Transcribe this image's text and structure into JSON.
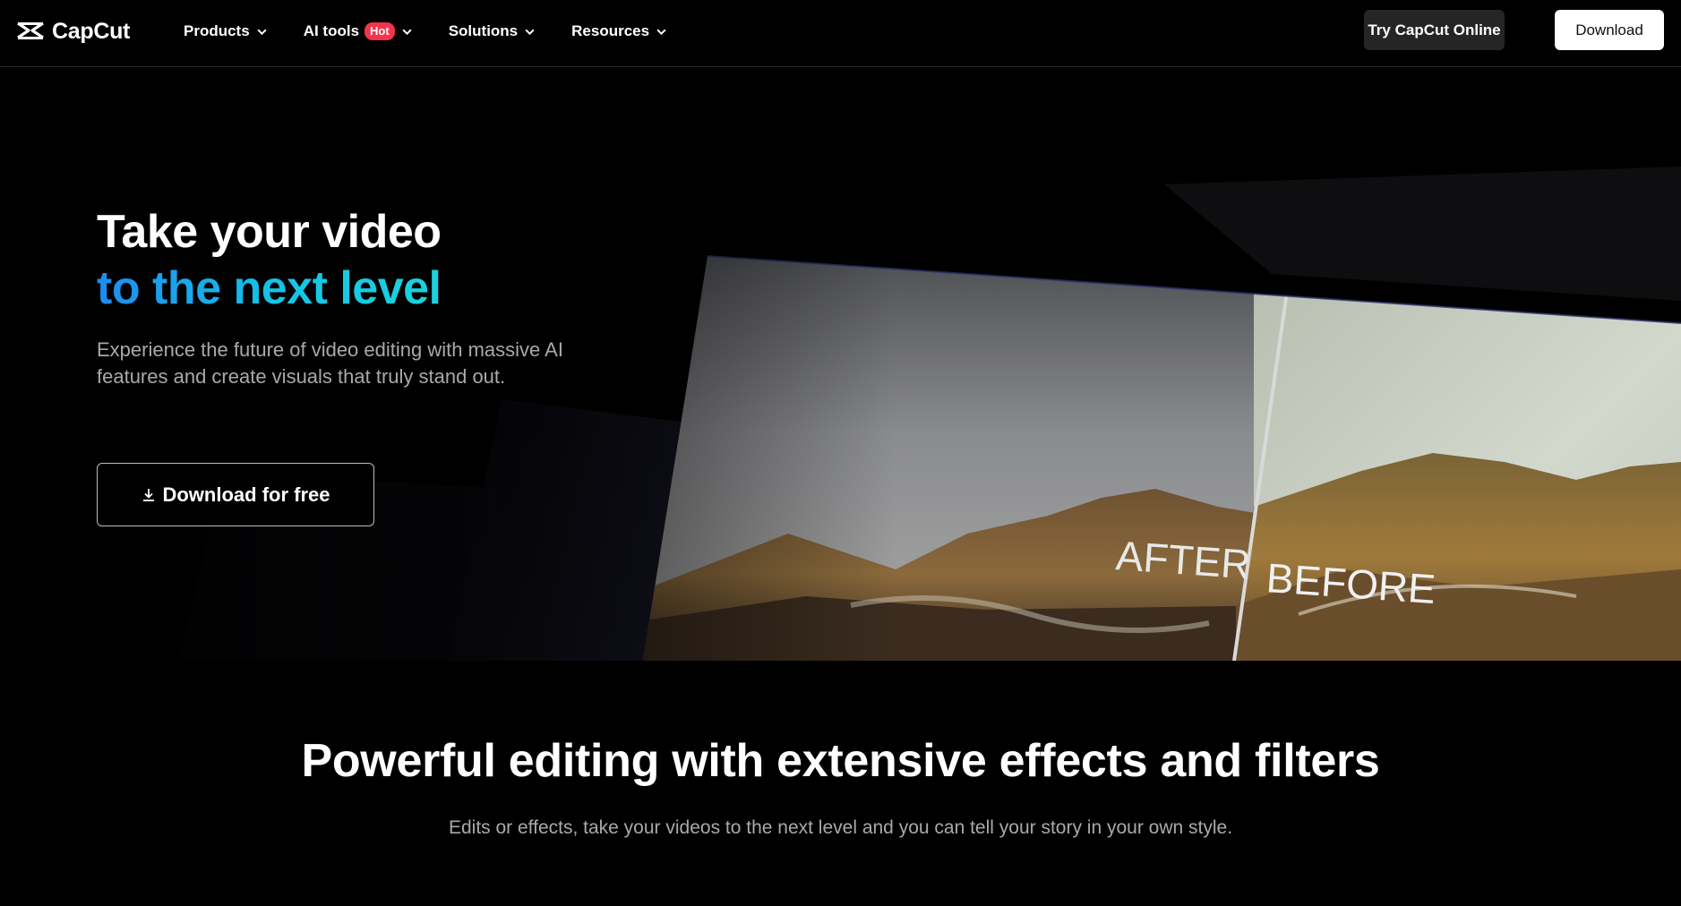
{
  "brand": {
    "name": "CapCut",
    "icon": "capcut-logo-icon"
  },
  "nav": {
    "items": [
      {
        "label": "Products",
        "icon": "chevron-down-icon"
      },
      {
        "label": "AI tools",
        "badge": "Hot",
        "icon": "chevron-down-icon"
      },
      {
        "label": "Solutions",
        "icon": "chevron-down-icon"
      },
      {
        "label": "Resources",
        "icon": "chevron-down-icon"
      }
    ],
    "try_online": "Try CapCut Online",
    "download": "Download"
  },
  "hero": {
    "title_line1": "Take your video",
    "title_line2": "to the next level",
    "subtitle": "Experience the future of video editing with massive AI features and create visuals that truly stand out.",
    "cta_label": "Download for free",
    "cta_icon": "download-icon",
    "after_label": "AFTER",
    "before_label": "BEFORE"
  },
  "section": {
    "title": "Powerful editing with extensive effects and filters",
    "subtitle": "Edits or effects, take your videos to the next level and you can tell your story in your own style."
  },
  "colors": {
    "background": "#000000",
    "accent_gradient_start": "#1e8bf0",
    "accent_gradient_end": "#22e3d3",
    "hot_badge": "#f4334d"
  }
}
